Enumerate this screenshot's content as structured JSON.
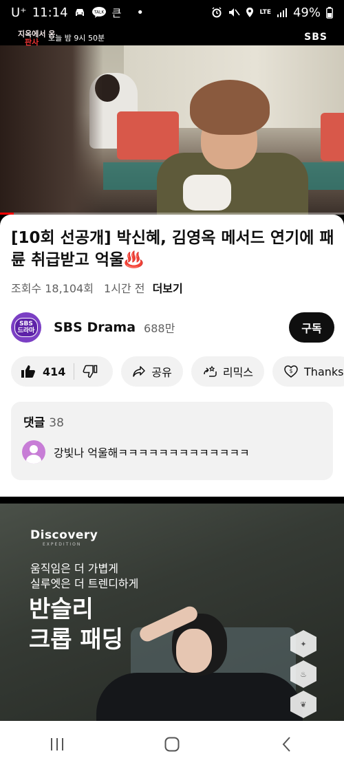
{
  "status_bar": {
    "carrier": "U⁺",
    "time": "11:14",
    "talk_badge": "TALK",
    "extra_icon": "큰",
    "dot": "•",
    "network": "LTE",
    "battery": "49%"
  },
  "video": {
    "program_logo_line1": "지옥에서 온",
    "program_logo_line2": "판사",
    "broadcast_time": "오늘 밤 9시 50분",
    "channel_logo": "SBS",
    "progress_fraction": 0.04
  },
  "details": {
    "title": "[10회 선공개] 박신혜, 김영옥 메서드 연기에 패륜 취급받고 억울♨️",
    "views": "조회수 18,104회",
    "time_ago": "1시간 전",
    "more": "더보기"
  },
  "channel": {
    "avatar_line1": "SBS",
    "avatar_line2": "드라마",
    "name": "SBS Drama",
    "subscribers": "688만",
    "subscribe_label": "구독"
  },
  "actions": {
    "likes": "414",
    "share": "공유",
    "remix": "리믹스",
    "thanks": "Thanks"
  },
  "comments": {
    "label": "댓글",
    "count": "38",
    "top_comment": "강빛나 억울해ㅋㅋㅋㅋㅋㅋㅋㅋㅋㅋㅋㅋㅋ"
  },
  "ad": {
    "logo": "Discovery",
    "logo_sub": "EXPEDITION",
    "copy_line1": "움직임은 더 가볍게",
    "copy_line2": "실루엣은 더 트렌디하게",
    "headline_line1": "반슬리",
    "headline_line2": "크롭 패딩"
  },
  "navbar": {
    "recents_icon": "recents-icon",
    "home_icon": "home-icon",
    "back_icon": "back-icon"
  }
}
